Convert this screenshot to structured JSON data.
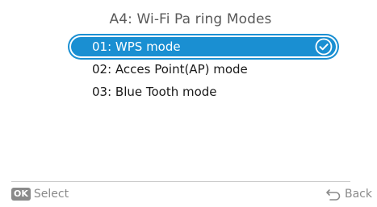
{
  "title": "A4: Wi-Fi Pa ring Modes",
  "menu": {
    "items": [
      {
        "label": "01: WPS mode",
        "selected": true
      },
      {
        "label": "02: Acces Point(AP) mode",
        "selected": false
      },
      {
        "label": "03: Blue Tooth mode",
        "selected": false
      }
    ]
  },
  "footer": {
    "ok_badge": "OK",
    "select_label": "Select",
    "back_label": "Back",
    "back_icon": "return-arrow-icon"
  },
  "colors": {
    "accent": "#1a8fd2",
    "text": "#1a1a1a",
    "muted": "#8a8a8a"
  }
}
